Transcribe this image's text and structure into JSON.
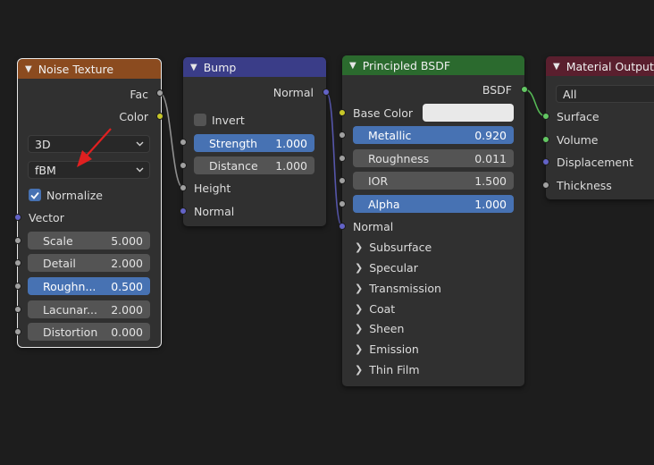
{
  "colors": {
    "noise_header": "#8b4b1f",
    "bump_header": "#3a3d88",
    "bsdf_header": "#2b6a2e",
    "output_header": "#5a1f2e",
    "socket_float": "#a1a1a1",
    "socket_color": "#c7c729",
    "socket_vector": "#6363c7",
    "socket_shader": "#63c763",
    "accent_blue": "#4772b3"
  },
  "noise": {
    "title": "Noise Texture",
    "outputs": {
      "fac": "Fac",
      "color": "Color"
    },
    "dimensions": "3D",
    "type": "fBM",
    "normalize": "Normalize",
    "normalize_checked": true,
    "vector": "Vector",
    "fields": [
      {
        "label": "Scale",
        "value": "5.000"
      },
      {
        "label": "Detail",
        "value": "2.000"
      },
      {
        "label": "Roughn...",
        "value": "0.500"
      },
      {
        "label": "Lacunar...",
        "value": "2.000"
      },
      {
        "label": "Distortion",
        "value": "0.000"
      }
    ]
  },
  "bump": {
    "title": "Bump",
    "output": "Normal",
    "invert": "Invert",
    "invert_checked": false,
    "fields": [
      {
        "label": "Strength",
        "value": "1.000"
      },
      {
        "label": "Distance",
        "value": "1.000"
      }
    ],
    "inputs": {
      "height": "Height",
      "normal": "Normal"
    }
  },
  "bsdf": {
    "title": "Principled BSDF",
    "output": "BSDF",
    "base_color": "Base Color",
    "fields": [
      {
        "label": "Metallic",
        "value": "0.920"
      },
      {
        "label": "Roughness",
        "value": "0.011"
      },
      {
        "label": "IOR",
        "value": "1.500"
      },
      {
        "label": "Alpha",
        "value": "1.000"
      }
    ],
    "normal": "Normal",
    "panels": [
      "Subsurface",
      "Specular",
      "Transmission",
      "Coat",
      "Sheen",
      "Emission",
      "Thin Film"
    ]
  },
  "output": {
    "title": "Material Output",
    "target": "All",
    "inputs": [
      "Surface",
      "Volume",
      "Displacement",
      "Thickness"
    ]
  },
  "icons": {
    "collapse": "chevron-down-icon",
    "expand": "chevron-right-icon",
    "check": "checkmark-icon",
    "annotation": "red-arrow-icon"
  }
}
